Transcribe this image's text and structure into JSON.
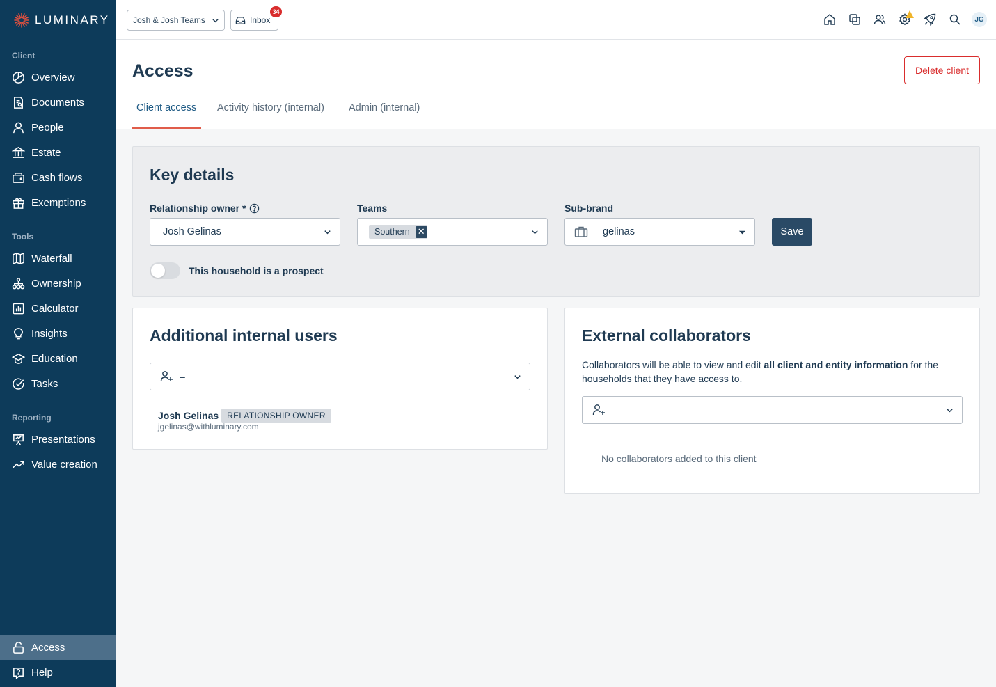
{
  "app": {
    "name": "LUMINARY"
  },
  "sidebar": {
    "sections": [
      {
        "label": "Client",
        "items": [
          {
            "label": "Overview",
            "icon": "overview-icon"
          },
          {
            "label": "Documents",
            "icon": "documents-icon"
          },
          {
            "label": "People",
            "icon": "people-icon"
          },
          {
            "label": "Estate",
            "icon": "estate-icon"
          },
          {
            "label": "Cash flows",
            "icon": "cash-flows-icon"
          },
          {
            "label": "Exemptions",
            "icon": "gift-icon"
          }
        ]
      },
      {
        "label": "Tools",
        "items": [
          {
            "label": "Waterfall",
            "icon": "map-icon"
          },
          {
            "label": "Ownership",
            "icon": "ownership-icon"
          },
          {
            "label": "Calculator",
            "icon": "calculator-icon"
          },
          {
            "label": "Insights",
            "icon": "lightbulb-icon"
          },
          {
            "label": "Education",
            "icon": "graduation-cap-icon"
          },
          {
            "label": "Tasks",
            "icon": "check-circle-icon"
          }
        ]
      },
      {
        "label": "Reporting",
        "items": [
          {
            "label": "Presentations",
            "icon": "presentation-icon"
          },
          {
            "label": "Value creation",
            "icon": "trend-up-icon"
          }
        ]
      }
    ],
    "bottom": [
      {
        "label": "Access",
        "icon": "lock-icon",
        "active": true
      },
      {
        "label": "Help",
        "icon": "help-icon"
      }
    ]
  },
  "topbar": {
    "team_select": "Josh & Josh Teams",
    "inbox_label": "Inbox",
    "inbox_count": "34",
    "avatar_initials": "JG",
    "icons": [
      "home-icon",
      "copy-icon",
      "users-icon",
      "settings-icon",
      "rocket-icon",
      "search-icon"
    ]
  },
  "page": {
    "title": "Access",
    "delete_label": "Delete client",
    "tabs": [
      {
        "label": "Client access",
        "active": true
      },
      {
        "label": "Activity history (internal)"
      },
      {
        "label": "Admin (internal)"
      }
    ]
  },
  "key_details": {
    "title": "Key details",
    "relationship_owner_label": "Relationship owner *",
    "relationship_owner_value": "Josh Gelinas",
    "teams_label": "Teams",
    "teams_chip": "Southern",
    "sub_brand_label": "Sub-brand",
    "sub_brand_value": "gelinas",
    "save_label": "Save",
    "prospect_label": "This household is a prospect",
    "prospect_on": false
  },
  "internal_users": {
    "title": "Additional internal users",
    "select_value": "–",
    "user_name": "Josh Gelinas",
    "user_badge": "RELATIONSHIP OWNER",
    "user_email": "jgelinas@withluminary.com"
  },
  "external": {
    "title": "External collaborators",
    "desc_pre": "Collaborators will be able to view and edit ",
    "desc_bold": "all client and entity information",
    "desc_post": " for the households that they have access to.",
    "select_value": "–",
    "empty": "No collaborators added to this client"
  },
  "colors": {
    "sidebar": "#0d3b5a",
    "active_nav": "#4d6f8a",
    "danger": "#d92d2d",
    "primary": "#2a4a66",
    "tab_underline": "#e05c4a"
  }
}
